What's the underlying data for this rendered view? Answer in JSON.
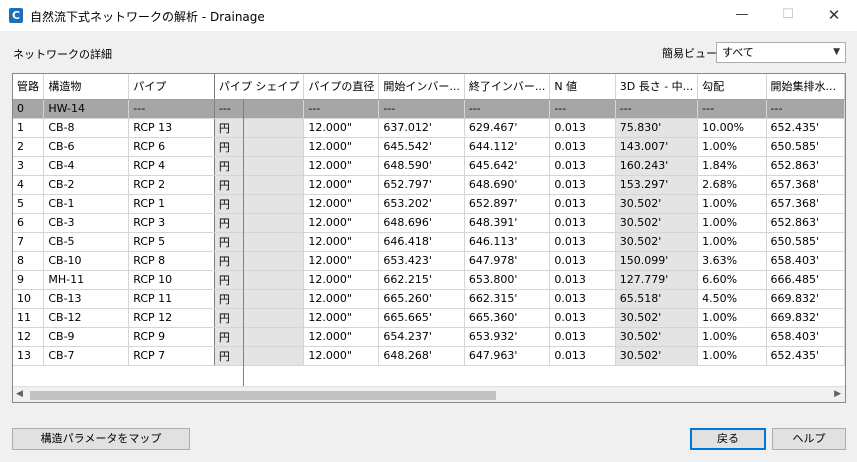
{
  "window": {
    "app_icon": "C",
    "title": "自然流下式ネットワークの解析 - Drainage",
    "minimize": "—",
    "maximize": "☐",
    "close": "✕"
  },
  "panel": {
    "section_label": "ネットワークの詳細",
    "view_label": "簡易ビュー",
    "view_selected": "すべて"
  },
  "table": {
    "headers": [
      "管路",
      "構造物",
      "パイプ",
      "パイプ シェイプ",
      "パイプの直径",
      "開始インバー...",
      "終了インバー...",
      "N 値",
      "3D 長さ - 中...",
      "勾配",
      "開始集排水..."
    ],
    "rows": [
      [
        "0",
        "HW-14",
        "---",
        "---",
        "---",
        "---",
        "---",
        "---",
        "---",
        "---",
        "---"
      ],
      [
        "1",
        "CB-8",
        "RCP 13",
        "円",
        "12.000\"",
        "637.012'",
        "629.467'",
        "0.013",
        "75.830'",
        "10.00%",
        "652.435'"
      ],
      [
        "2",
        "CB-6",
        "RCP 6",
        "円",
        "12.000\"",
        "645.542'",
        "644.112'",
        "0.013",
        "143.007'",
        "1.00%",
        "650.585'"
      ],
      [
        "3",
        "CB-4",
        "RCP 4",
        "円",
        "12.000\"",
        "648.590'",
        "645.642'",
        "0.013",
        "160.243'",
        "1.84%",
        "652.863'"
      ],
      [
        "4",
        "CB-2",
        "RCP 2",
        "円",
        "12.000\"",
        "652.797'",
        "648.690'",
        "0.013",
        "153.297'",
        "2.68%",
        "657.368'"
      ],
      [
        "5",
        "CB-1",
        "RCP 1",
        "円",
        "12.000\"",
        "653.202'",
        "652.897'",
        "0.013",
        "30.502'",
        "1.00%",
        "657.368'"
      ],
      [
        "6",
        "CB-3",
        "RCP 3",
        "円",
        "12.000\"",
        "648.696'",
        "648.391'",
        "0.013",
        "30.502'",
        "1.00%",
        "652.863'"
      ],
      [
        "7",
        "CB-5",
        "RCP 5",
        "円",
        "12.000\"",
        "646.418'",
        "646.113'",
        "0.013",
        "30.502'",
        "1.00%",
        "650.585'"
      ],
      [
        "8",
        "CB-10",
        "RCP 8",
        "円",
        "12.000\"",
        "653.423'",
        "647.978'",
        "0.013",
        "150.099'",
        "3.63%",
        "658.403'"
      ],
      [
        "9",
        "MH-11",
        "RCP 10",
        "円",
        "12.000\"",
        "662.215'",
        "653.800'",
        "0.013",
        "127.779'",
        "6.60%",
        "666.485'"
      ],
      [
        "10",
        "CB-13",
        "RCP 11",
        "円",
        "12.000\"",
        "665.260'",
        "662.315'",
        "0.013",
        "65.518'",
        "4.50%",
        "669.832'"
      ],
      [
        "11",
        "CB-12",
        "RCP 12",
        "円",
        "12.000\"",
        "665.665'",
        "665.360'",
        "0.013",
        "30.502'",
        "1.00%",
        "669.832'"
      ],
      [
        "12",
        "CB-9",
        "RCP 9",
        "円",
        "12.000\"",
        "654.237'",
        "653.932'",
        "0.013",
        "30.502'",
        "1.00%",
        "658.403'"
      ],
      [
        "13",
        "CB-7",
        "RCP 7",
        "円",
        "12.000\"",
        "648.268'",
        "647.963'",
        "0.013",
        "30.502'",
        "1.00%",
        "652.435'"
      ]
    ]
  },
  "buttons": {
    "map_params": "構造パラメータをマップ",
    "back": "戻る",
    "help": "ヘルプ"
  },
  "icons": {
    "scroll_left": "◀",
    "scroll_right": "▶",
    "dropdown": "▼"
  }
}
